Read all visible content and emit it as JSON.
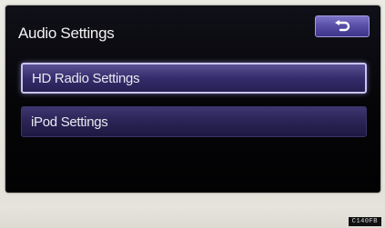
{
  "screen": {
    "title": "Audio Settings",
    "back_icon": "return-arrow-icon"
  },
  "menu": {
    "items": [
      {
        "label": "HD Radio Settings",
        "selected": true
      },
      {
        "label": "iPod Settings",
        "selected": false
      }
    ]
  },
  "footer": {
    "code": "C140FB"
  },
  "colors": {
    "screen_background": "#050508",
    "button_purple": "#5a4fa8",
    "selected_border": "#c9c3f2",
    "text": "#f2f2f2"
  }
}
